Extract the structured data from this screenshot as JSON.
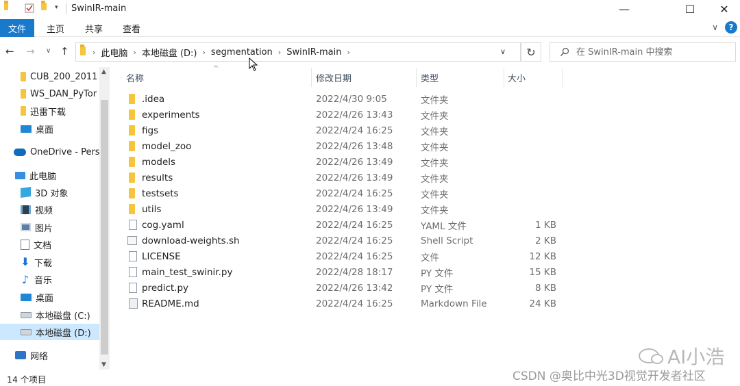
{
  "window": {
    "title": "SwinIR-main",
    "minimize_glyph": "—",
    "maximize_glyph": "☐",
    "close_glyph": "✕"
  },
  "ribbon": {
    "tabs": [
      {
        "label": "文件",
        "active": true
      },
      {
        "label": "主页"
      },
      {
        "label": "共享"
      },
      {
        "label": "查看"
      }
    ],
    "help_glyph": "?",
    "expand_glyph": "∨"
  },
  "address": {
    "crumbs": [
      "此电脑",
      "本地磁盘 (D:)",
      "segmentation",
      "SwinIR-main"
    ],
    "search_placeholder": "在 SwinIR-main 中搜索"
  },
  "sidebar": {
    "items": [
      {
        "label": "CUB_200_2011",
        "icon": "folder-icon"
      },
      {
        "label": "WS_DAN_PyTor",
        "icon": "folder-icon"
      },
      {
        "label": "迅雷下载",
        "icon": "folder-icon"
      },
      {
        "label": "桌面",
        "icon": "desktop-icon"
      },
      {
        "label": "OneDrive - Perso",
        "icon": "onedrive-icon"
      },
      {
        "label": "此电脑",
        "icon": "pc-icon"
      },
      {
        "label": "3D 对象",
        "icon": "3d-objects-icon"
      },
      {
        "label": "视频",
        "icon": "video-icon"
      },
      {
        "label": "图片",
        "icon": "pictures-icon"
      },
      {
        "label": "文档",
        "icon": "documents-icon"
      },
      {
        "label": "下载",
        "icon": "download-icon"
      },
      {
        "label": "音乐",
        "icon": "music-icon"
      },
      {
        "label": "桌面",
        "icon": "desktop-icon"
      },
      {
        "label": "本地磁盘 (C:)",
        "icon": "drive-c-icon"
      },
      {
        "label": "本地磁盘 (D:)",
        "icon": "drive-d-icon",
        "selected": true
      },
      {
        "label": "网络",
        "icon": "network-icon"
      }
    ]
  },
  "columns": {
    "name": "名称",
    "date": "修改日期",
    "type": "类型",
    "size": "大小"
  },
  "files": [
    {
      "name": ".idea",
      "date": "2022/4/30 9:05",
      "type": "文件夹",
      "size": "",
      "kind": "folder"
    },
    {
      "name": "experiments",
      "date": "2022/4/26 13:43",
      "type": "文件夹",
      "size": "",
      "kind": "folder"
    },
    {
      "name": "figs",
      "date": "2022/4/24 16:25",
      "type": "文件夹",
      "size": "",
      "kind": "folder"
    },
    {
      "name": "model_zoo",
      "date": "2022/4/26 13:48",
      "type": "文件夹",
      "size": "",
      "kind": "folder"
    },
    {
      "name": "models",
      "date": "2022/4/26 13:49",
      "type": "文件夹",
      "size": "",
      "kind": "folder"
    },
    {
      "name": "results",
      "date": "2022/4/26 13:49",
      "type": "文件夹",
      "size": "",
      "kind": "folder"
    },
    {
      "name": "testsets",
      "date": "2022/4/24 16:25",
      "type": "文件夹",
      "size": "",
      "kind": "folder"
    },
    {
      "name": "utils",
      "date": "2022/4/26 13:49",
      "type": "文件夹",
      "size": "",
      "kind": "folder"
    },
    {
      "name": "cog.yaml",
      "date": "2022/4/24 16:25",
      "type": "YAML 文件",
      "size": "1 KB",
      "kind": "file"
    },
    {
      "name": "download-weights.sh",
      "date": "2022/4/24 16:25",
      "type": "Shell Script",
      "size": "2 KB",
      "kind": "script"
    },
    {
      "name": "LICENSE",
      "date": "2022/4/24 16:25",
      "type": "文件",
      "size": "12 KB",
      "kind": "file"
    },
    {
      "name": "main_test_swinir.py",
      "date": "2022/4/28 18:17",
      "type": "PY 文件",
      "size": "15 KB",
      "kind": "file"
    },
    {
      "name": "predict.py",
      "date": "2022/4/26 13:42",
      "type": "PY 文件",
      "size": "8 KB",
      "kind": "file"
    },
    {
      "name": "README.md",
      "date": "2022/4/24 16:25",
      "type": "Markdown File",
      "size": "24 KB",
      "kind": "md"
    }
  ],
  "status": {
    "item_count": "14 个项目"
  },
  "watermark": {
    "logo_text": "AI小浩",
    "credit": "CSDN @奥比中光3D视觉开发者社区"
  }
}
